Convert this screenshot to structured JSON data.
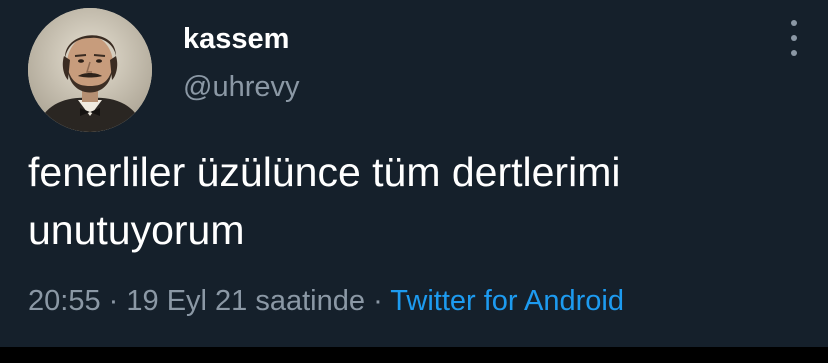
{
  "user": {
    "display_name": "kassem",
    "handle": "@uhrevy"
  },
  "tweet": {
    "text": "fenerliler üzülünce tüm dertlerimi unutuyorum",
    "time": "20:55",
    "separator": "·",
    "date": "19 Eyl 21 saatinde",
    "source": "Twitter for Android"
  },
  "icons": {
    "more": "more-vertical-icon",
    "avatar": "user-avatar-portrait"
  },
  "colors": {
    "background": "#15202b",
    "text_primary": "#ffffff",
    "text_secondary": "#8b98a5",
    "link": "#1d9bf0"
  }
}
